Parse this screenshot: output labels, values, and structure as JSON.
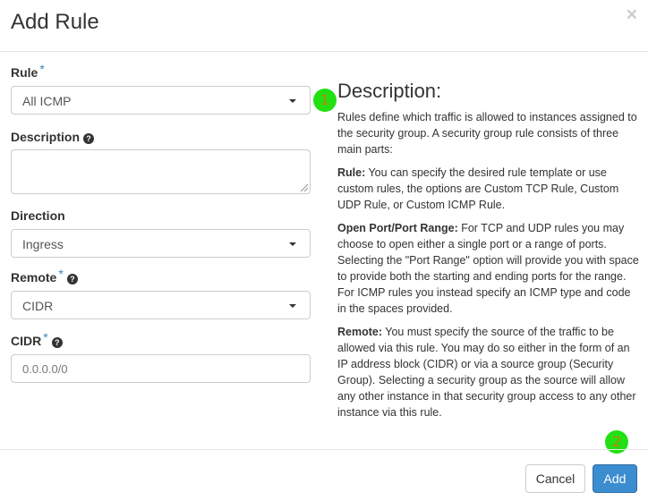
{
  "header": {
    "title": "Add Rule",
    "close_icon": "×"
  },
  "form": {
    "rule": {
      "label": "Rule",
      "required_mark": "*",
      "value": "All ICMP"
    },
    "description": {
      "label": "Description",
      "help_icon": "?",
      "value": ""
    },
    "direction": {
      "label": "Direction",
      "value": "Ingress"
    },
    "remote": {
      "label": "Remote",
      "required_mark": "*",
      "help_icon": "?",
      "value": "CIDR"
    },
    "cidr": {
      "label": "CIDR",
      "required_mark": "*",
      "help_icon": "?",
      "value": "0.0.0.0/0"
    }
  },
  "description_panel": {
    "title": "Description:",
    "intro": "Rules define which traffic is allowed to instances assigned to the security group. A security group rule consists of three main parts:",
    "rule_heading": "Rule:",
    "rule_text": " You can specify the desired rule template or use custom rules, the options are Custom TCP Rule, Custom UDP Rule, or Custom ICMP Rule.",
    "port_heading": "Open Port/Port Range:",
    "port_text": " For TCP and UDP rules you may choose to open either a single port or a range of ports. Selecting the \"Port Range\" option will provide you with space to provide both the starting and ending ports for the range. For ICMP rules you instead specify an ICMP type and code in the spaces provided.",
    "remote_heading": "Remote:",
    "remote_text": " You must specify the source of the traffic to be allowed via this rule. You may do so either in the form of an IP address block (CIDR) or via a source group (Security Group). Selecting a security group as the source will allow any other instance in that security group access to any other instance via this rule."
  },
  "footer": {
    "cancel_label": "Cancel",
    "add_label": "Add"
  },
  "markers": {
    "marker_1": "1",
    "marker_2": "2",
    "color": "#22e012"
  },
  "colors": {
    "primary_button": "#3c8dd0",
    "required_mark": "#3a87ad"
  }
}
